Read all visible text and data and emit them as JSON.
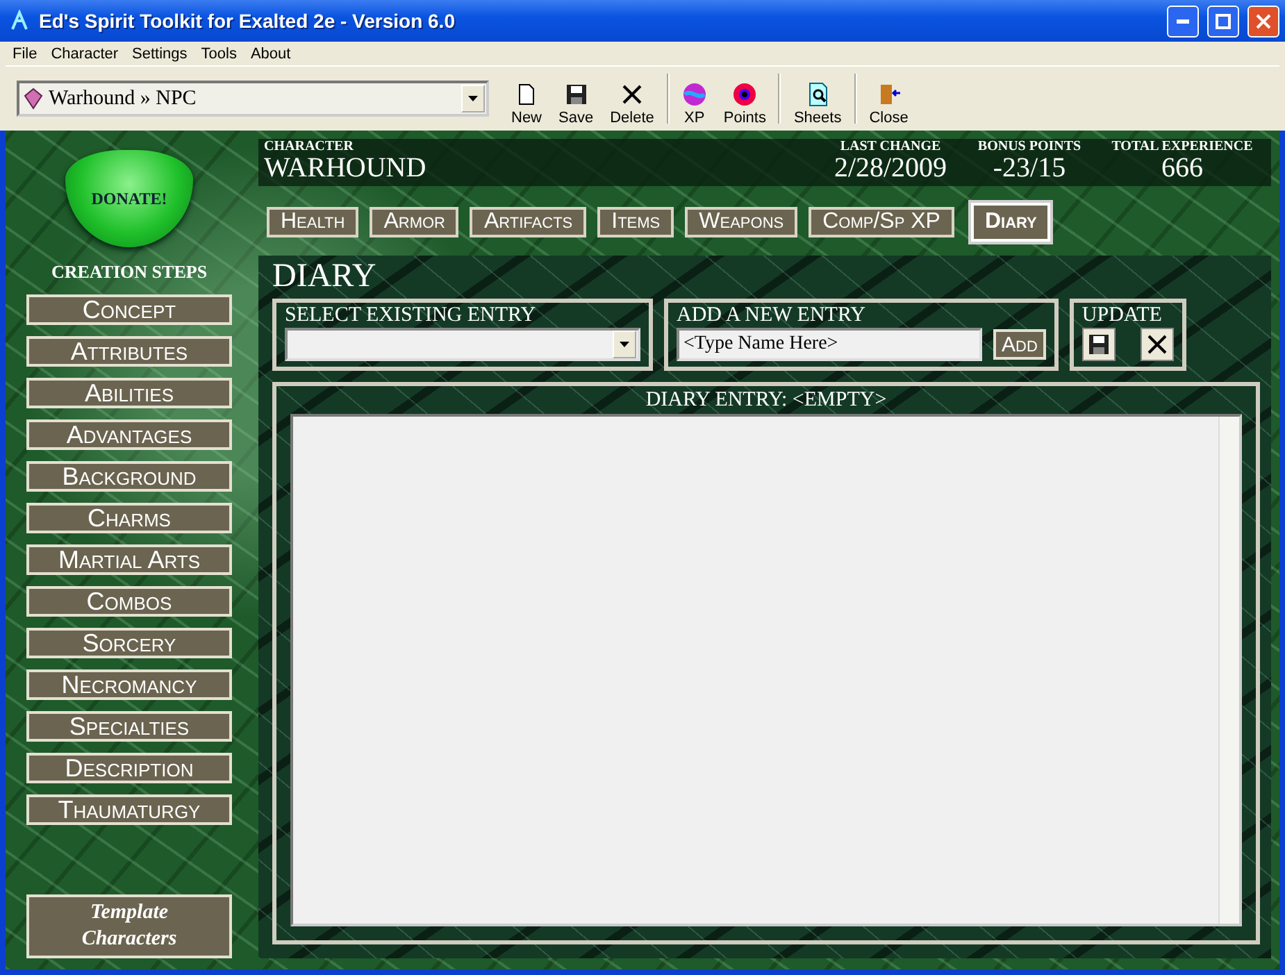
{
  "window": {
    "title": "Ed's Spirit Toolkit for Exalted 2e - Version 6.0"
  },
  "menu": [
    "File",
    "Character",
    "Settings",
    "Tools",
    "About"
  ],
  "character_picker": {
    "value": "Warhound » NPC"
  },
  "toolbar": [
    {
      "label": "New",
      "kind": "new"
    },
    {
      "label": "Save",
      "kind": "save"
    },
    {
      "label": "Delete",
      "kind": "delete"
    },
    {
      "label": "XP",
      "kind": "xp"
    },
    {
      "label": "Points",
      "kind": "points"
    },
    {
      "label": "Sheets",
      "kind": "sheets"
    },
    {
      "label": "Close",
      "kind": "close"
    }
  ],
  "donate": {
    "label": "DONATE!"
  },
  "sidebar": {
    "title": "CREATION STEPS",
    "items": [
      "Concept",
      "Attributes",
      "Abilities",
      "Advantages",
      "Background",
      "Charms",
      "Martial Arts",
      "Combos",
      "Sorcery",
      "Necromancy",
      "Specialties",
      "Description",
      "Thaumaturgy"
    ],
    "template_button": "Template Characters"
  },
  "header": {
    "character_label": "CHARACTER",
    "character": "WARHOUND",
    "stats": [
      {
        "label": "LAST CHANGE",
        "value": "2/28/2009"
      },
      {
        "label": "BONUS POINTS",
        "value": "-23/15"
      },
      {
        "label": "TOTAL EXPERIENCE",
        "value": "666"
      }
    ]
  },
  "tabs": [
    {
      "label": "Health",
      "selected": false
    },
    {
      "label": "Armor",
      "selected": false
    },
    {
      "label": "Artifacts",
      "selected": false
    },
    {
      "label": "Items",
      "selected": false
    },
    {
      "label": "Weapons",
      "selected": false
    },
    {
      "label": "Comp/Sp XP",
      "selected": false
    },
    {
      "label": "Diary",
      "selected": true
    }
  ],
  "diary": {
    "title": "DIARY",
    "select_label": "SELECT EXISTING ENTRY",
    "add_label": "ADD A NEW ENTRY",
    "add_value": "<Type Name Here>",
    "add_button": "Add",
    "update_label": "UPDATE",
    "entry_title": "DIARY ENTRY: <EMPTY>"
  }
}
